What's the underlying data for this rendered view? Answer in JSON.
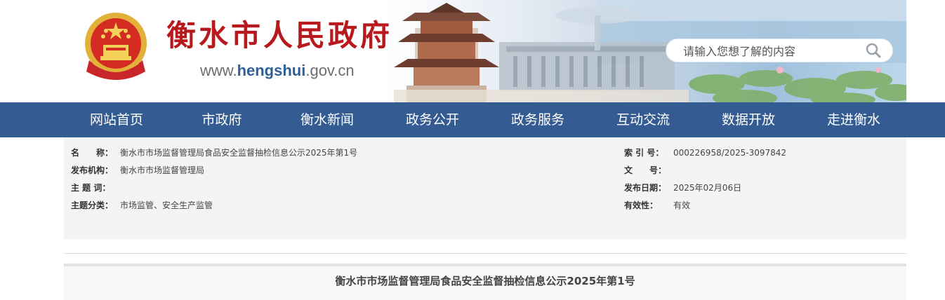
{
  "header": {
    "site_title": "衡水市人民政府",
    "url_prefix": "www.",
    "url_domain": "hengshui",
    "url_suffix": ".gov.cn",
    "emblem_icon": "national-emblem-icon",
    "search": {
      "placeholder": "请输入您想了解的内容",
      "button_icon": "search-icon"
    }
  },
  "nav": {
    "items": [
      {
        "label": "网站首页"
      },
      {
        "label": "市政府"
      },
      {
        "label": "衡水新闻"
      },
      {
        "label": "政务公开"
      },
      {
        "label": "政务服务"
      },
      {
        "label": "互动交流"
      },
      {
        "label": "数据开放"
      },
      {
        "label": "走进衡水"
      }
    ]
  },
  "meta": {
    "name_label": "名　　称：",
    "name_value": "衡水市市场监督管理局食品安全监督抽检信息公示2025年第1号",
    "publisher_label": "发布机构：",
    "publisher_value": "衡水市市场监督管理局",
    "keywords_label": "主 题 词：",
    "keywords_value": "",
    "category_label": "主题分类：",
    "category_value": "市场监管、安全生产监管",
    "index_label": "索 引 号：",
    "index_value": "000226958/2025-3097842",
    "docno_label": "文　　号：",
    "docno_value": "",
    "date_label": "发布日期：",
    "date_value": "2025年02月06日",
    "validity_label": "有效性：",
    "validity_value": "有效"
  },
  "document": {
    "title": "衡水市市场监督管理局食品安全监督抽检信息公示2025年第1号"
  },
  "colors": {
    "nav_bg": "#345c93",
    "title_red": "#b7191c",
    "url_blue": "#2f5f97"
  }
}
